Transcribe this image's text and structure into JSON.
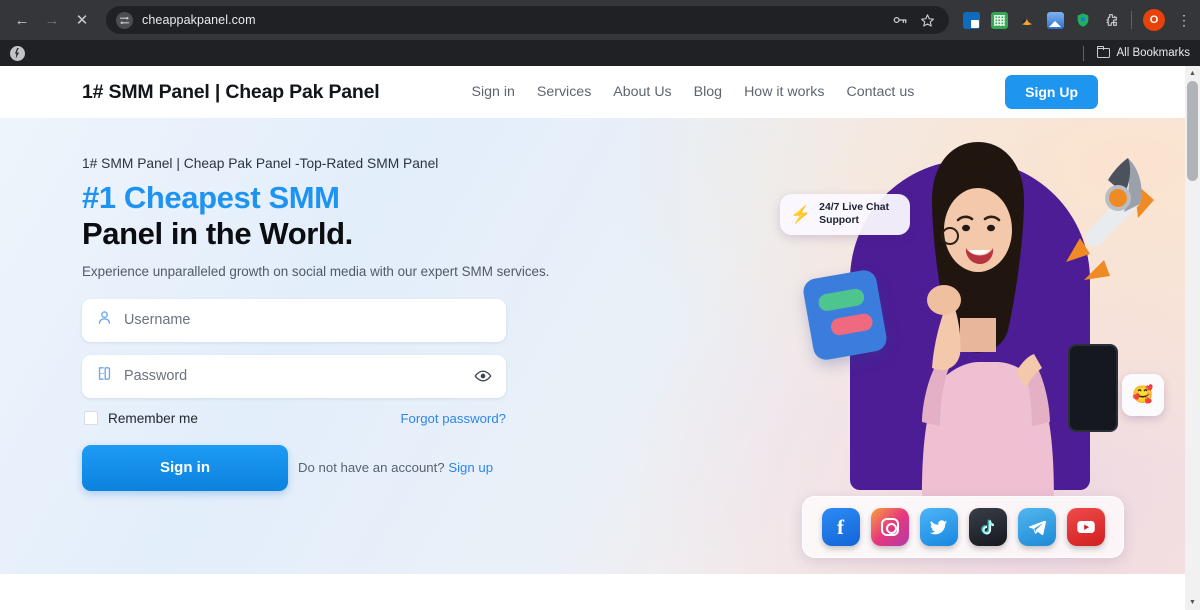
{
  "browser": {
    "back_icon": "back-arrow-icon",
    "forward_icon": "forward-arrow-icon",
    "stop_icon": "stop-loading-icon",
    "url": "cheappakpanel.com",
    "tune_icon": "page-settings-icon",
    "passkey_icon": "passkey-icon",
    "bookmark_star_icon": "star-icon",
    "extensions": [
      {
        "name": "outlook-extension-icon"
      },
      {
        "name": "sheets-extension-icon"
      },
      {
        "name": "honey-extension-icon"
      },
      {
        "name": "image-extension-icon"
      },
      {
        "name": "shield-extension-icon"
      },
      {
        "name": "puzzle-extensions-icon"
      }
    ],
    "profile_initial": "O",
    "menu_icon": "kebab-menu-icon",
    "bookmarks_bar": {
      "favicon": "site-favicon-icon",
      "all_bookmarks_label": "All Bookmarks",
      "folder_icon": "folder-icon"
    }
  },
  "site": {
    "logo": "1# SMM Panel | Cheap Pak Panel",
    "nav": [
      {
        "label": "Sign in"
      },
      {
        "label": "Services"
      },
      {
        "label": "About Us"
      },
      {
        "label": "Blog"
      },
      {
        "label": "How it works"
      },
      {
        "label": "Contact us"
      }
    ],
    "signup_button": "Sign Up"
  },
  "hero": {
    "eyebrow": "1# SMM Panel | Cheap Pak Panel -Top-Rated SMM Panel",
    "headline_accent": "#1 Cheapest SMM",
    "headline_dark": "Panel in the World.",
    "subtitle": "Experience unparalleled growth on social media with our expert SMM services.",
    "form": {
      "username_placeholder": "Username",
      "username_value": "",
      "username_icon": "user-icon",
      "password_placeholder": "Password",
      "password_value": "",
      "password_icon": "lock-icon",
      "toggle_password_icon": "eye-icon",
      "remember_label": "Remember me",
      "remember_checked": false,
      "forgot_label": "Forgot password?",
      "signin_button": "Sign in",
      "no_account_text": "Do not have an account?",
      "signup_link": "Sign up"
    },
    "badge": {
      "bolt_icon": "lightning-bolt-icon",
      "line1": "24/7 Live Chat",
      "line2": "Support"
    },
    "emoji_badge": "🥰",
    "social_icons": [
      {
        "name": "facebook-icon",
        "glyph": "f"
      },
      {
        "name": "instagram-icon",
        "glyph": ""
      },
      {
        "name": "twitter-icon",
        "glyph": "🐦"
      },
      {
        "name": "tiktok-icon",
        "glyph": "♪"
      },
      {
        "name": "telegram-icon",
        "glyph": "➤"
      },
      {
        "name": "youtube-icon",
        "glyph": "▶"
      }
    ],
    "illustration": {
      "person": "smiling-woman-photo",
      "rocket": "rocket-icon",
      "phone": "smartphone-icon",
      "card": "blue-card-icon"
    }
  },
  "colors": {
    "accent_blue": "#1e96f0",
    "headline_blue": "#1f93f2",
    "purple_backdrop": "#4c1d95",
    "bolt_orange": "#f59e0b"
  }
}
